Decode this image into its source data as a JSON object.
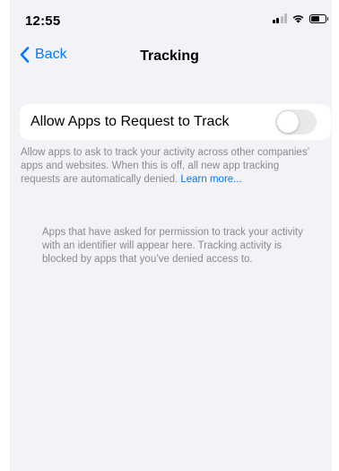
{
  "status_bar": {
    "time": "12:55",
    "icons": [
      "cellular-signal-icon",
      "wifi-icon",
      "battery-icon"
    ]
  },
  "nav": {
    "back_label": "Back",
    "title": "Tracking"
  },
  "settings": {
    "allow_tracking": {
      "label": "Allow Apps to Request to Track",
      "enabled": false
    },
    "footnote_text": "Allow apps to ask to track your activity across other companies’ apps and websites. When this is off, all new app tracking requests are automatically denied. ",
    "footnote_link": "Learn more..."
  },
  "info_note": "Apps that have asked for permission to track your activity with an identifier will appear here. Tracking activity is blocked by apps that you’ve denied access to.",
  "colors": {
    "accent": "#007aff",
    "background": "#f2f2f7",
    "secondary_text": "#8a8a8e",
    "toggle_off": "#e9e9eb"
  }
}
